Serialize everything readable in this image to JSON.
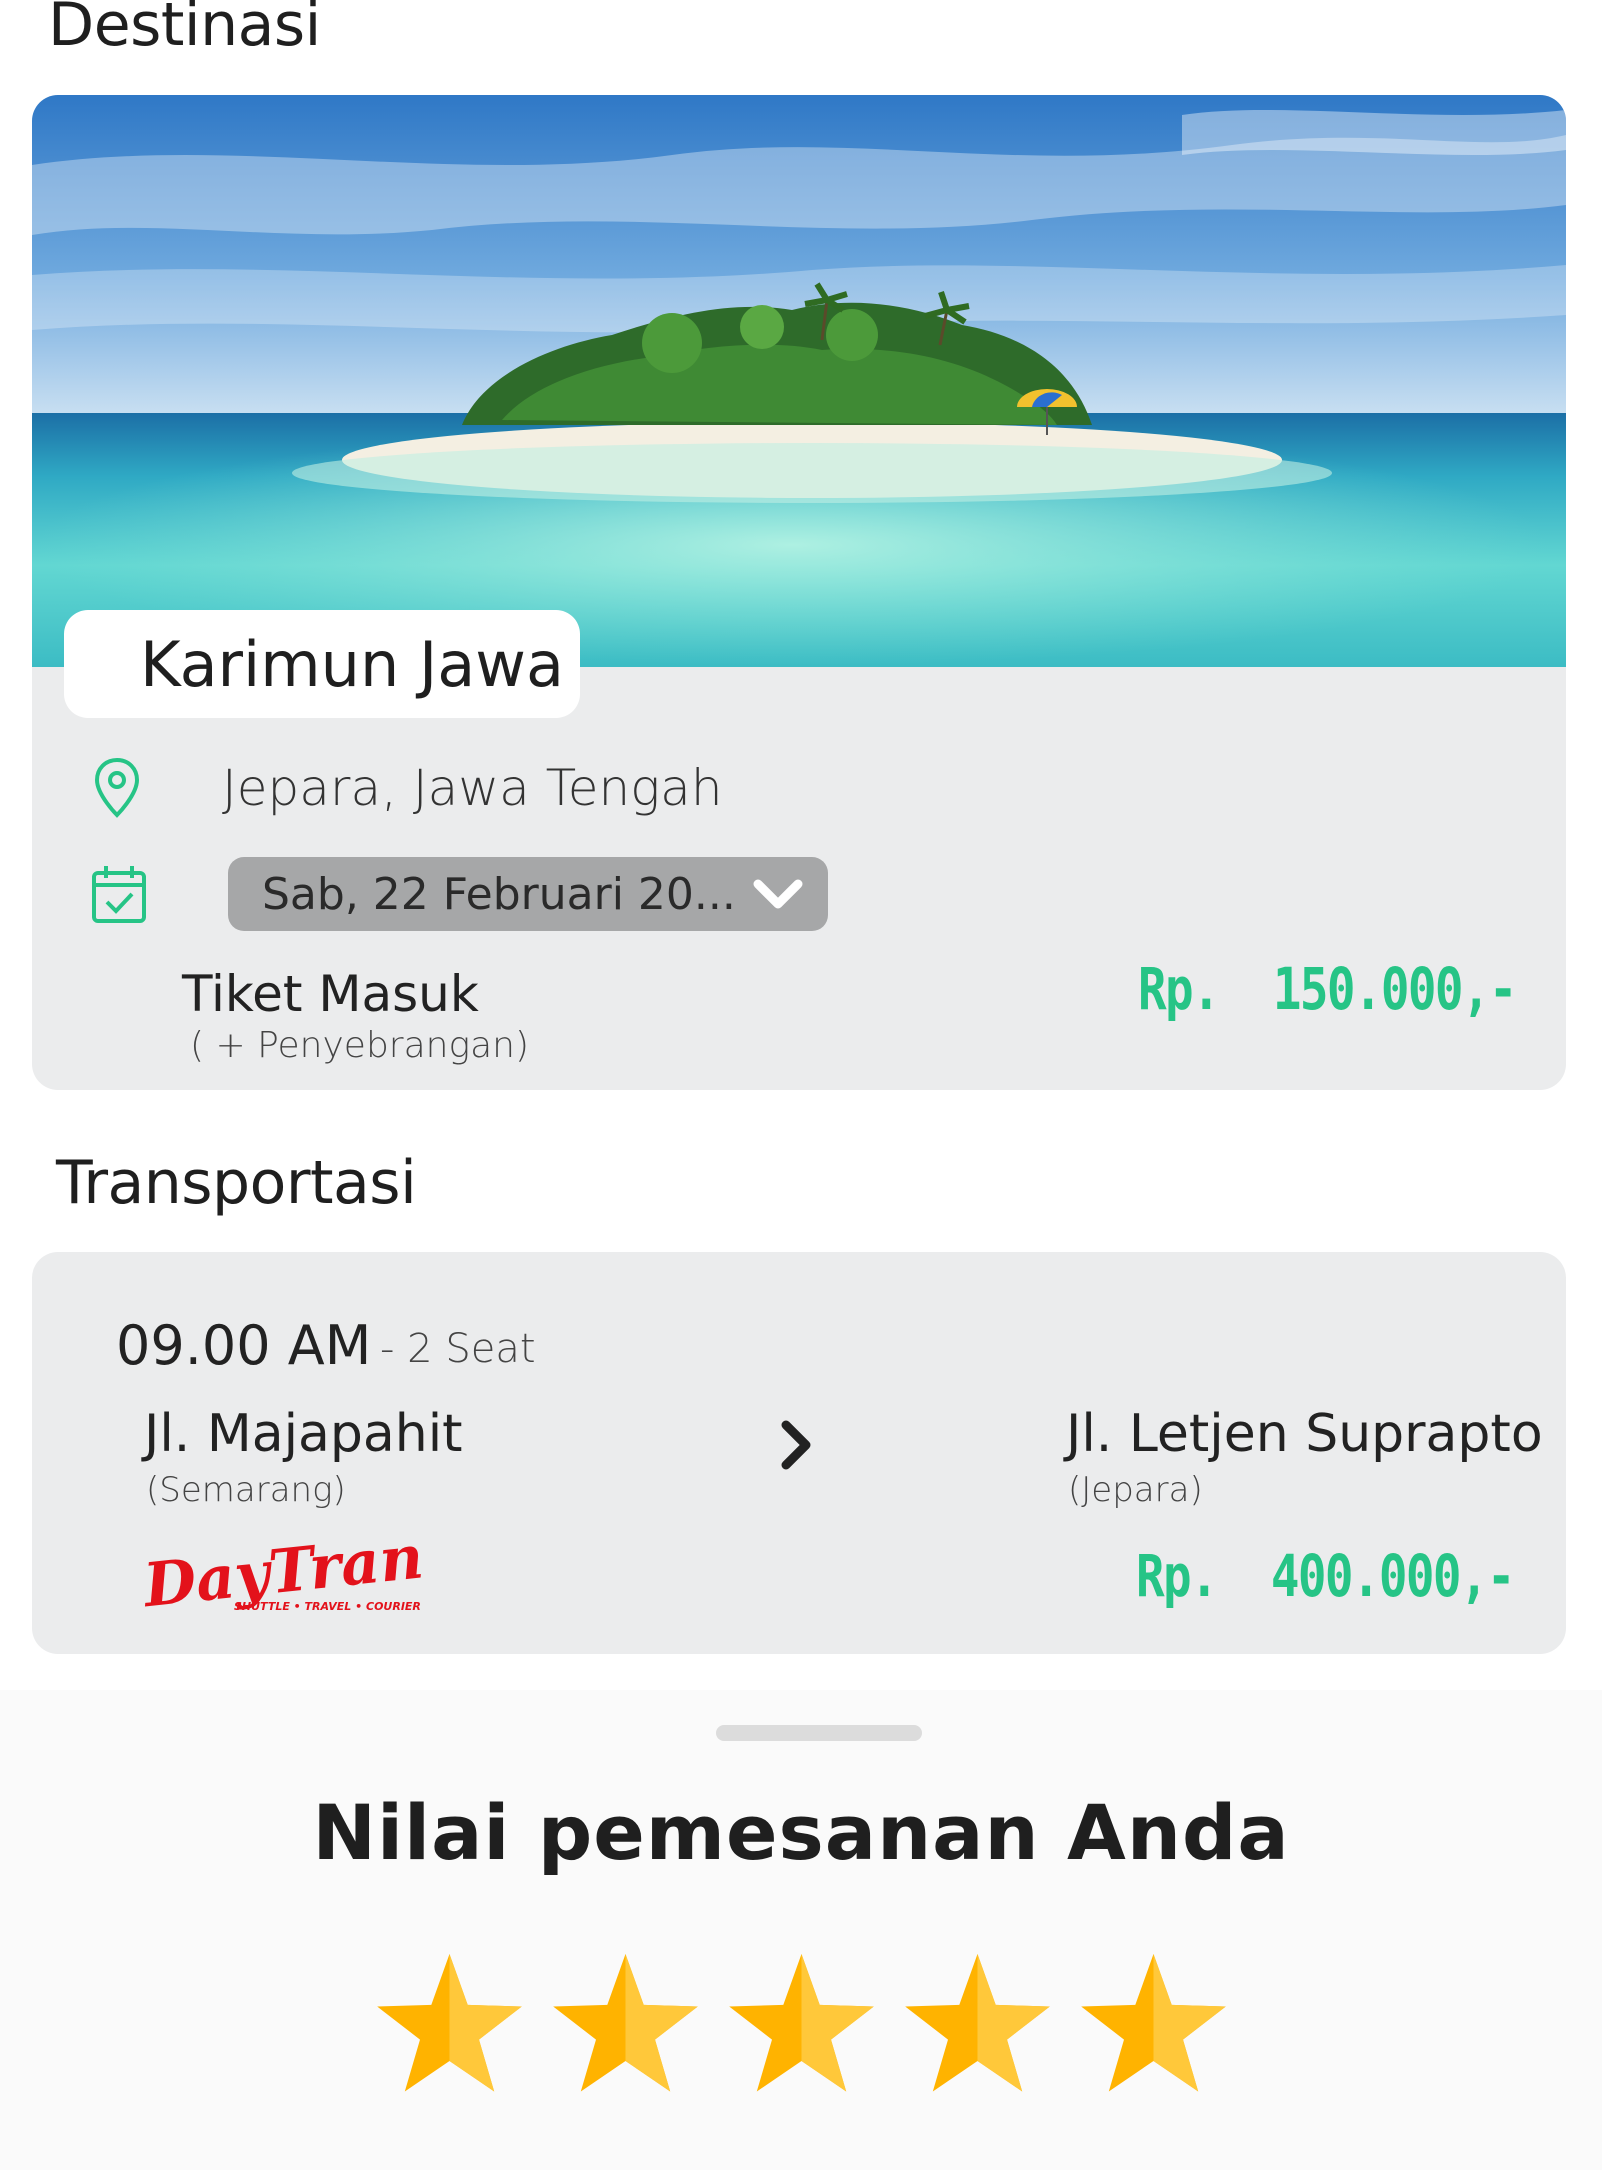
{
  "destination_section": {
    "title": "Destinasi",
    "name": "Karimun Jawa",
    "location": "Jepara, Jawa Tengah",
    "date_selected": "Sab, 22 Februari 20...",
    "ticket_label": "Tiket Masuk",
    "ticket_sublabel": "( + Penyebrangan)",
    "ticket_price": "Rp.  150.000,-"
  },
  "transport_section": {
    "title": "Transportasi",
    "time": "09.00 AM",
    "seats": "- 2 Seat",
    "from": "Jl. Majapahit",
    "from_city": "(Semarang)",
    "to": "Jl. Letjen Suprapto",
    "to_city": "(Jepara)",
    "operator_logo_text": "DayTrans",
    "operator_tagline": "SHUTTLE • TRAVEL • COURIER",
    "price": "Rp.  400.000,-"
  },
  "rating_sheet": {
    "title": "Nilai pemesanan Anda",
    "rating": 5,
    "max_rating": 5
  },
  "colors": {
    "accent_green": "#26c486",
    "star": "#ffb300",
    "card_bg": "#ebeced",
    "logo_red": "#e3121b"
  },
  "icons": [
    "location-pin-icon",
    "calendar-check-icon",
    "chevron-down-icon",
    "chevron-right-icon",
    "star-icon"
  ]
}
